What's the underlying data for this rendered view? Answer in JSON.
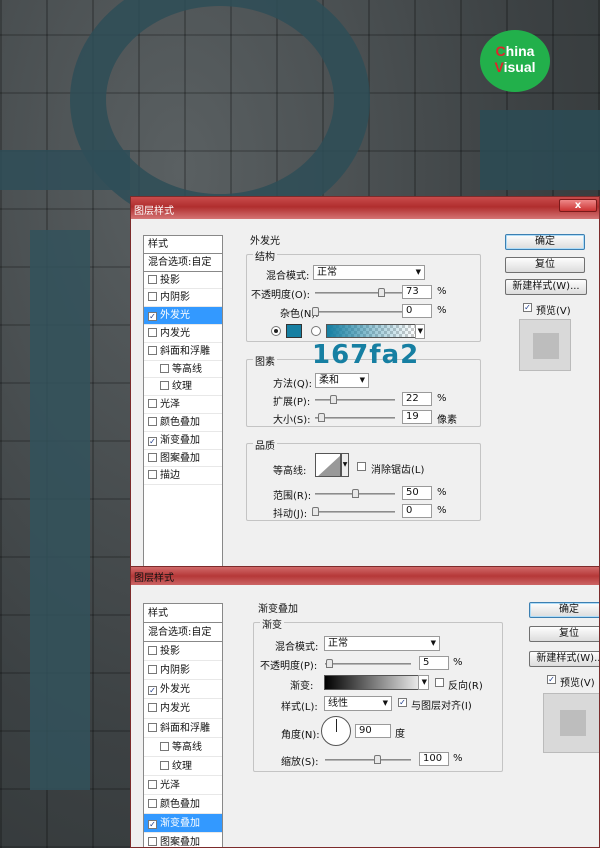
{
  "logo": {
    "line1_first": "C",
    "line1_rest": "hina",
    "line2_first": "V",
    "line2_rest": "isual"
  },
  "annotation": {
    "hex": "167fa2"
  },
  "dialog1": {
    "title": "图层样式",
    "close": "x",
    "style_list": [
      {
        "label": "样式",
        "type": "head"
      },
      {
        "label": "混合选项:自定",
        "type": "head"
      },
      {
        "label": "投影",
        "checked": false
      },
      {
        "label": "内阴影",
        "checked": false
      },
      {
        "label": "外发光",
        "checked": true,
        "selected": true
      },
      {
        "label": "内发光",
        "checked": false
      },
      {
        "label": "斜面和浮雕",
        "checked": false
      },
      {
        "label": "等高线",
        "checked": false,
        "indent": true
      },
      {
        "label": "纹理",
        "checked": false,
        "indent": true
      },
      {
        "label": "光泽",
        "checked": false
      },
      {
        "label": "颜色叠加",
        "checked": false
      },
      {
        "label": "渐变叠加",
        "checked": true
      },
      {
        "label": "图案叠加",
        "checked": false
      },
      {
        "label": "描边",
        "checked": false
      }
    ],
    "section_title": "外发光",
    "structure": {
      "title": "结构",
      "blend_mode_label": "混合模式:",
      "blend_mode_value": "正常",
      "opacity_label": "不透明度(O):",
      "opacity_value": "73",
      "opacity_pct": 73,
      "noise_label": "杂色(N):",
      "noise_value": "0",
      "noise_pct": 0,
      "unit": "%",
      "glow_color": "#167fa2"
    },
    "elements": {
      "title": "图素",
      "method_label": "方法(Q):",
      "method_value": "柔和",
      "spread_label": "扩展(P):",
      "spread_value": "22",
      "spread_pct": 22,
      "size_label": "大小(S):",
      "size_value": "19",
      "size_pct": 8,
      "unit": "%",
      "size_unit": "像素"
    },
    "quality": {
      "title": "品质",
      "contour_label": "等高线:",
      "anti_alias_label": "消除锯齿(L)",
      "range_label": "范围(R):",
      "range_value": "50",
      "range_pct": 50,
      "jitter_label": "抖动(J):",
      "jitter_value": "0",
      "jitter_pct": 0,
      "unit": "%"
    },
    "buttons": {
      "ok": "确定",
      "reset": "复位",
      "new_style": "新建样式(W)...",
      "preview": "预览(V)"
    }
  },
  "dialog2": {
    "title": "图层样式",
    "style_list": [
      {
        "label": "样式",
        "type": "head"
      },
      {
        "label": "混合选项:自定",
        "type": "head"
      },
      {
        "label": "投影",
        "checked": false
      },
      {
        "label": "内阴影",
        "checked": false
      },
      {
        "label": "外发光",
        "checked": true
      },
      {
        "label": "内发光",
        "checked": false
      },
      {
        "label": "斜面和浮雕",
        "checked": false
      },
      {
        "label": "等高线",
        "checked": false,
        "indent": true
      },
      {
        "label": "纹理",
        "checked": false,
        "indent": true
      },
      {
        "label": "光泽",
        "checked": false
      },
      {
        "label": "颜色叠加",
        "checked": false
      },
      {
        "label": "渐变叠加",
        "checked": true,
        "selected": true
      },
      {
        "label": "图案叠加",
        "checked": false
      }
    ],
    "section_title": "渐变叠加",
    "gradient": {
      "title": "渐变",
      "blend_mode_label": "混合模式:",
      "blend_mode_value": "正常",
      "opacity_label": "不透明度(P):",
      "opacity_value": "5",
      "opacity_pct": 5,
      "unit": "%",
      "gradient_label": "渐变:",
      "reverse_label": "反向(R)",
      "style_label": "样式(L):",
      "style_value": "线性",
      "align_label": "与图层对齐(I)",
      "angle_label": "角度(N):",
      "angle_value": "90",
      "angle_unit": "度",
      "scale_label": "缩放(S):",
      "scale_value": "100",
      "scale_pct": 100
    },
    "buttons": {
      "ok": "确定",
      "reset": "复位",
      "new_style": "新建样式(W)...",
      "preview": "预览(V)"
    }
  }
}
